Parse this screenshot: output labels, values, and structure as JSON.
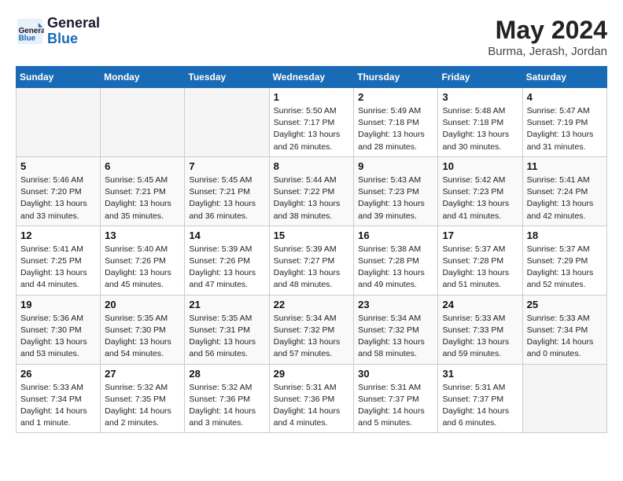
{
  "header": {
    "logo_line1": "General",
    "logo_line2": "Blue",
    "month": "May 2024",
    "location": "Burma, Jerash, Jordan"
  },
  "days_of_week": [
    "Sunday",
    "Monday",
    "Tuesday",
    "Wednesday",
    "Thursday",
    "Friday",
    "Saturday"
  ],
  "weeks": [
    [
      {
        "day": "",
        "info": ""
      },
      {
        "day": "",
        "info": ""
      },
      {
        "day": "",
        "info": ""
      },
      {
        "day": "1",
        "info": "Sunrise: 5:50 AM\nSunset: 7:17 PM\nDaylight: 13 hours and 26 minutes."
      },
      {
        "day": "2",
        "info": "Sunrise: 5:49 AM\nSunset: 7:18 PM\nDaylight: 13 hours and 28 minutes."
      },
      {
        "day": "3",
        "info": "Sunrise: 5:48 AM\nSunset: 7:18 PM\nDaylight: 13 hours and 30 minutes."
      },
      {
        "day": "4",
        "info": "Sunrise: 5:47 AM\nSunset: 7:19 PM\nDaylight: 13 hours and 31 minutes."
      }
    ],
    [
      {
        "day": "5",
        "info": "Sunrise: 5:46 AM\nSunset: 7:20 PM\nDaylight: 13 hours and 33 minutes."
      },
      {
        "day": "6",
        "info": "Sunrise: 5:45 AM\nSunset: 7:21 PM\nDaylight: 13 hours and 35 minutes."
      },
      {
        "day": "7",
        "info": "Sunrise: 5:45 AM\nSunset: 7:21 PM\nDaylight: 13 hours and 36 minutes."
      },
      {
        "day": "8",
        "info": "Sunrise: 5:44 AM\nSunset: 7:22 PM\nDaylight: 13 hours and 38 minutes."
      },
      {
        "day": "9",
        "info": "Sunrise: 5:43 AM\nSunset: 7:23 PM\nDaylight: 13 hours and 39 minutes."
      },
      {
        "day": "10",
        "info": "Sunrise: 5:42 AM\nSunset: 7:23 PM\nDaylight: 13 hours and 41 minutes."
      },
      {
        "day": "11",
        "info": "Sunrise: 5:41 AM\nSunset: 7:24 PM\nDaylight: 13 hours and 42 minutes."
      }
    ],
    [
      {
        "day": "12",
        "info": "Sunrise: 5:41 AM\nSunset: 7:25 PM\nDaylight: 13 hours and 44 minutes."
      },
      {
        "day": "13",
        "info": "Sunrise: 5:40 AM\nSunset: 7:26 PM\nDaylight: 13 hours and 45 minutes."
      },
      {
        "day": "14",
        "info": "Sunrise: 5:39 AM\nSunset: 7:26 PM\nDaylight: 13 hours and 47 minutes."
      },
      {
        "day": "15",
        "info": "Sunrise: 5:39 AM\nSunset: 7:27 PM\nDaylight: 13 hours and 48 minutes."
      },
      {
        "day": "16",
        "info": "Sunrise: 5:38 AM\nSunset: 7:28 PM\nDaylight: 13 hours and 49 minutes."
      },
      {
        "day": "17",
        "info": "Sunrise: 5:37 AM\nSunset: 7:28 PM\nDaylight: 13 hours and 51 minutes."
      },
      {
        "day": "18",
        "info": "Sunrise: 5:37 AM\nSunset: 7:29 PM\nDaylight: 13 hours and 52 minutes."
      }
    ],
    [
      {
        "day": "19",
        "info": "Sunrise: 5:36 AM\nSunset: 7:30 PM\nDaylight: 13 hours and 53 minutes."
      },
      {
        "day": "20",
        "info": "Sunrise: 5:35 AM\nSunset: 7:30 PM\nDaylight: 13 hours and 54 minutes."
      },
      {
        "day": "21",
        "info": "Sunrise: 5:35 AM\nSunset: 7:31 PM\nDaylight: 13 hours and 56 minutes."
      },
      {
        "day": "22",
        "info": "Sunrise: 5:34 AM\nSunset: 7:32 PM\nDaylight: 13 hours and 57 minutes."
      },
      {
        "day": "23",
        "info": "Sunrise: 5:34 AM\nSunset: 7:32 PM\nDaylight: 13 hours and 58 minutes."
      },
      {
        "day": "24",
        "info": "Sunrise: 5:33 AM\nSunset: 7:33 PM\nDaylight: 13 hours and 59 minutes."
      },
      {
        "day": "25",
        "info": "Sunrise: 5:33 AM\nSunset: 7:34 PM\nDaylight: 14 hours and 0 minutes."
      }
    ],
    [
      {
        "day": "26",
        "info": "Sunrise: 5:33 AM\nSunset: 7:34 PM\nDaylight: 14 hours and 1 minute."
      },
      {
        "day": "27",
        "info": "Sunrise: 5:32 AM\nSunset: 7:35 PM\nDaylight: 14 hours and 2 minutes."
      },
      {
        "day": "28",
        "info": "Sunrise: 5:32 AM\nSunset: 7:36 PM\nDaylight: 14 hours and 3 minutes."
      },
      {
        "day": "29",
        "info": "Sunrise: 5:31 AM\nSunset: 7:36 PM\nDaylight: 14 hours and 4 minutes."
      },
      {
        "day": "30",
        "info": "Sunrise: 5:31 AM\nSunset: 7:37 PM\nDaylight: 14 hours and 5 minutes."
      },
      {
        "day": "31",
        "info": "Sunrise: 5:31 AM\nSunset: 7:37 PM\nDaylight: 14 hours and 6 minutes."
      },
      {
        "day": "",
        "info": ""
      }
    ]
  ]
}
